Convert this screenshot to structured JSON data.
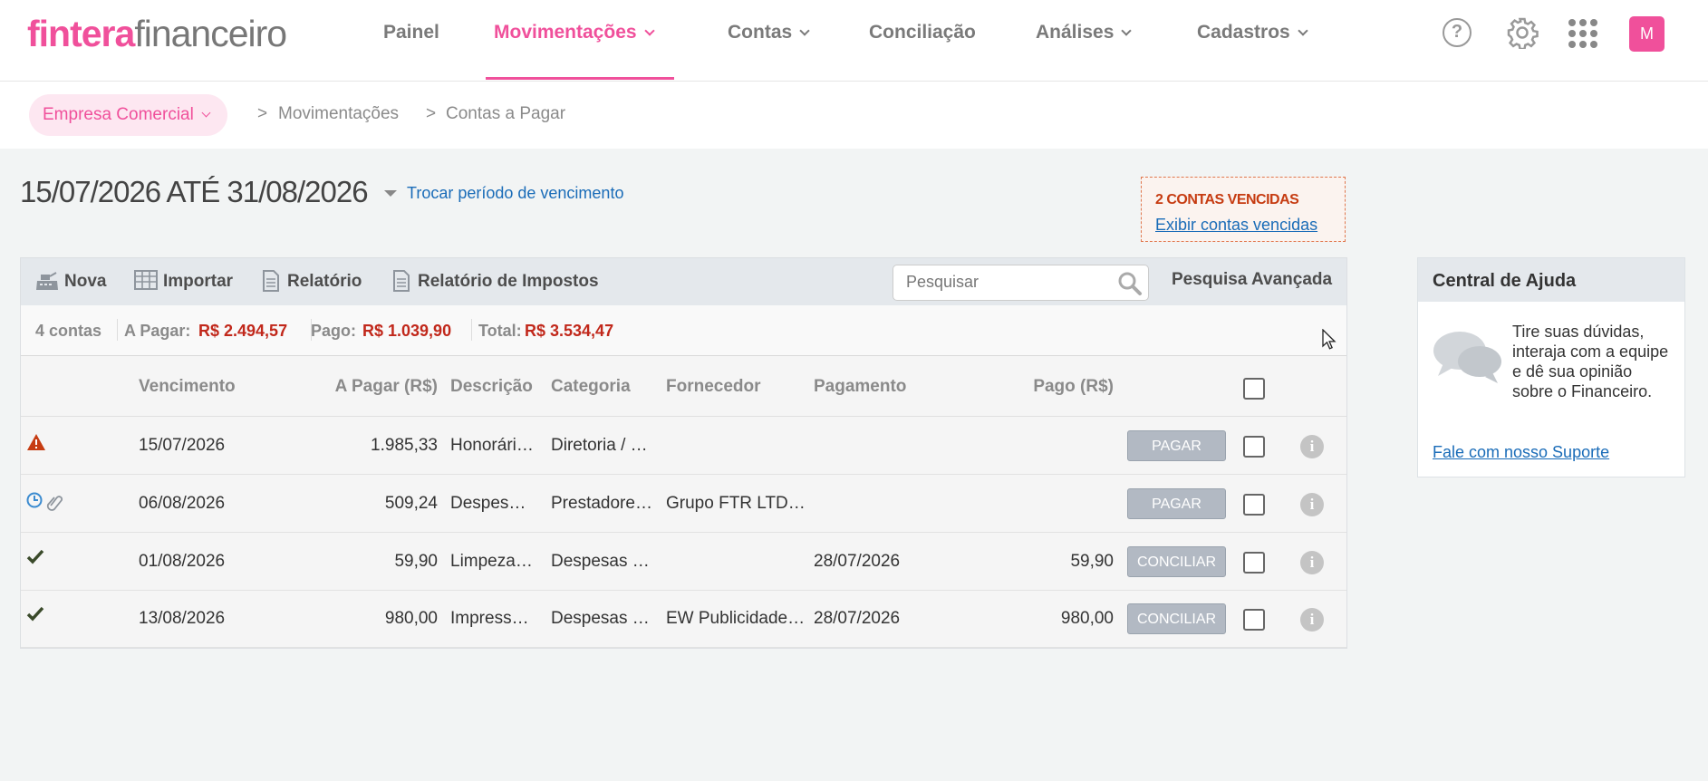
{
  "brand": {
    "bold": "fintera",
    "light": "financeiro"
  },
  "nav": {
    "painel": "Painel",
    "movimentacoes": "Movimentações",
    "contas": "Contas",
    "conciliacao": "Conciliação",
    "analises": "Análises",
    "cadastros": "Cadastros"
  },
  "user": {
    "initial": "M"
  },
  "breadcrumb": {
    "company": "Empresa Comercial",
    "level1": "Movimentações",
    "level2": "Contas a Pagar",
    "separator": ">"
  },
  "period": {
    "title": "15/07/2026 ATÉ 31/08/2026",
    "change_link": "Trocar período de vencimento"
  },
  "overdue": {
    "title": "2 CONTAS VENCIDAS",
    "link": "Exibir contas vencidas"
  },
  "toolbar": {
    "nova": "Nova",
    "importar": "Importar",
    "relatorio": "Relatório",
    "relatorio_impostos": "Relatório de Impostos",
    "search_placeholder": "Pesquisar",
    "advanced_search": "Pesquisa Avançada"
  },
  "summary": {
    "count": "4 contas",
    "a_pagar_label": "A Pagar:",
    "a_pagar_value": "R$ 2.494,57",
    "pago_label": "Pago:",
    "pago_value": "R$ 1.039,90",
    "total_label": "Total:",
    "total_value": "R$ 3.534,47"
  },
  "columns": {
    "vencimento": "Vencimento",
    "a_pagar": "A Pagar (R$)",
    "descricao": "Descrição",
    "categoria": "Categoria",
    "fornecedor": "Fornecedor",
    "pagamento": "Pagamento",
    "pago": "Pago (R$)"
  },
  "rows": [
    {
      "status": "warning",
      "vencimento": "15/07/2026",
      "a_pagar": "1.985,33",
      "descricao": "Honorári…",
      "categoria": "Diretoria / …",
      "fornecedor": "",
      "pagamento": "",
      "pago": "",
      "action": "PAGAR"
    },
    {
      "status": "scheduled-attachment",
      "vencimento": "06/08/2026",
      "a_pagar": "509,24",
      "descricao": "Despes…",
      "categoria": "Prestadore…",
      "fornecedor": "Grupo FTR LTD…",
      "pagamento": "",
      "pago": "",
      "action": "PAGAR"
    },
    {
      "status": "paid",
      "vencimento": "01/08/2026",
      "a_pagar": "59,90",
      "descricao": "Limpeza…",
      "categoria": "Despesas …",
      "fornecedor": "",
      "pagamento": "28/07/2026",
      "pago": "59,90",
      "action": "CONCILIAR"
    },
    {
      "status": "paid",
      "vencimento": "13/08/2026",
      "a_pagar": "980,00",
      "descricao": "Impress…",
      "categoria": "Despesas …",
      "fornecedor": "EW Publicidade…",
      "pagamento": "28/07/2026",
      "pago": "980,00",
      "action": "CONCILIAR"
    }
  ],
  "help": {
    "title": "Central de Ajuda",
    "body": "Tire suas dúvidas, interaja com a equipe e dê sua opinião sobre o Financeiro.",
    "link": "Fale com nosso Suporte"
  },
  "colors": {
    "brand_pink": "#f0509b",
    "value_red": "#c1281b",
    "link_blue": "#1a6cb8",
    "warning_red": "#c63c12"
  }
}
